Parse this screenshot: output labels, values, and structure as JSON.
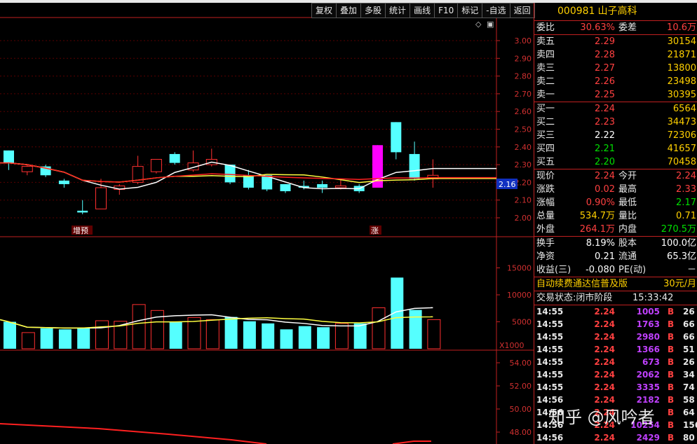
{
  "toolbar": [
    "复权",
    "叠加",
    "多股",
    "统计",
    "画线",
    "F10",
    "标记",
    "-自选",
    "返回"
  ],
  "stock": {
    "code": "000981",
    "name": "山子高科"
  },
  "ratio": {
    "label1": "委比",
    "value1": "30.63%",
    "label2": "委差",
    "value2": "10.6万"
  },
  "asks": [
    {
      "label": "卖五",
      "price": "2.29",
      "vol": "30154"
    },
    {
      "label": "卖四",
      "price": "2.28",
      "vol": "21871"
    },
    {
      "label": "卖三",
      "price": "2.27",
      "vol": "13800"
    },
    {
      "label": "卖二",
      "price": "2.26",
      "vol": "23498"
    },
    {
      "label": "卖一",
      "price": "2.25",
      "vol": "30395"
    }
  ],
  "bids": [
    {
      "label": "买一",
      "price": "2.24",
      "vol": "6564",
      "pc": "red"
    },
    {
      "label": "买二",
      "price": "2.23",
      "vol": "34473",
      "pc": "red"
    },
    {
      "label": "买三",
      "price": "2.22",
      "vol": "72306",
      "pc": "white"
    },
    {
      "label": "买四",
      "price": "2.21",
      "vol": "41657",
      "pc": "green"
    },
    {
      "label": "买五",
      "price": "2.20",
      "vol": "70458",
      "pc": "green"
    }
  ],
  "quote": [
    {
      "l1": "现价",
      "v1": "2.24",
      "v1c": "red",
      "l2": "今开",
      "v2": "2.24",
      "v2c": "red"
    },
    {
      "l1": "涨跌",
      "v1": "0.02",
      "v1c": "red",
      "l2": "最高",
      "v2": "2.33",
      "v2c": "red"
    },
    {
      "l1": "涨幅",
      "v1": "0.90%",
      "v1c": "red",
      "l2": "最低",
      "v2": "2.17",
      "v2c": "green"
    },
    {
      "l1": "总量",
      "v1": "534.7万",
      "v1c": "yellow",
      "l2": "量比",
      "v2": "0.71",
      "v2c": "yellow"
    },
    {
      "l1": "外盘",
      "v1": "264.1万",
      "v1c": "red",
      "l2": "内盘",
      "v2": "270.5万",
      "v2c": "green"
    }
  ],
  "fundamentals": [
    {
      "l1": "换手",
      "v1": "8.19%",
      "l2": "股本",
      "v2": "100.0亿"
    },
    {
      "l1": "净资",
      "v1": "0.21",
      "l2": "流通",
      "v2": "65.3亿"
    },
    {
      "l1": "收益(三)",
      "v1": "-0.080",
      "l2": "PE(动)",
      "v2": "－"
    }
  ],
  "promo": {
    "text": "自动续费通达信普及版",
    "price": "30元/月"
  },
  "status": {
    "text": "交易状态:闭市阶段",
    "time": "15:33:42"
  },
  "ticks": [
    {
      "time": "14:55",
      "price": "2.24",
      "vol": "1005",
      "bs": "B",
      "n": "26"
    },
    {
      "time": "14:55",
      "price": "2.24",
      "vol": "1763",
      "bs": "B",
      "n": "66"
    },
    {
      "time": "14:55",
      "price": "2.24",
      "vol": "2980",
      "bs": "B",
      "n": "66"
    },
    {
      "time": "14:55",
      "price": "2.24",
      "vol": "1366",
      "bs": "B",
      "n": "51"
    },
    {
      "time": "14:55",
      "price": "2.24",
      "vol": "673",
      "bs": "B",
      "n": "26"
    },
    {
      "time": "14:55",
      "price": "2.24",
      "vol": "2062",
      "bs": "B",
      "n": "34"
    },
    {
      "time": "14:55",
      "price": "2.24",
      "vol": "3335",
      "bs": "B",
      "n": "74"
    },
    {
      "time": "14:56",
      "price": "2.24",
      "vol": "2182",
      "bs": "B",
      "n": "58"
    },
    {
      "time": "14:56",
      "price": "2.24",
      "vol": "",
      "bs": "B",
      "n": "64"
    },
    {
      "time": "14:56",
      "price": "2.24",
      "vol": "10254",
      "bs": "B",
      "n": "156"
    },
    {
      "time": "14:56",
      "price": "2.24",
      "vol": "2429",
      "bs": "B",
      "n": "80"
    }
  ],
  "watermark": "知乎 @风吟者",
  "chart_data": {
    "type": "candlestick",
    "price_axis": [
      "3.00",
      "2.90",
      "2.80",
      "2.70",
      "2.60",
      "2.50",
      "2.40",
      "2.30",
      "2.20",
      "2.10",
      "2.00"
    ],
    "current_price_label": "2.16",
    "annotations": [
      "增预",
      "涨"
    ],
    "volume_axis": [
      "15000",
      "10000",
      "5000"
    ],
    "volume_unit": "X1000",
    "indicator_axis": [
      "54.00",
      "52.00",
      "50.00",
      "48.00"
    ],
    "candles": [
      {
        "o": 2.38,
        "c": 2.31,
        "h": 2.38,
        "l": 2.27
      },
      {
        "o": 2.26,
        "c": 2.29,
        "h": 2.3,
        "l": 2.24
      },
      {
        "o": 2.29,
        "c": 2.24,
        "h": 2.3,
        "l": 2.23
      },
      {
        "o": 2.21,
        "c": 2.19,
        "h": 2.22,
        "l": 2.17
      },
      {
        "o": 2.04,
        "c": 2.03,
        "h": 2.1,
        "l": 2.02
      },
      {
        "o": 2.05,
        "c": 2.17,
        "h": 2.22,
        "l": 2.05
      },
      {
        "o": 2.16,
        "c": 2.18,
        "h": 2.19,
        "l": 2.13
      },
      {
        "o": 2.2,
        "c": 2.29,
        "h": 2.35,
        "l": 2.19
      },
      {
        "o": 2.26,
        "c": 2.33,
        "h": 2.33,
        "l": 2.25
      },
      {
        "o": 2.36,
        "c": 2.31,
        "h": 2.37,
        "l": 2.3
      },
      {
        "o": 2.27,
        "c": 2.31,
        "h": 2.38,
        "l": 2.26
      },
      {
        "o": 2.3,
        "c": 2.33,
        "h": 2.39,
        "l": 2.29
      },
      {
        "o": 2.3,
        "c": 2.2,
        "h": 2.3,
        "l": 2.19
      },
      {
        "o": 2.24,
        "c": 2.17,
        "h": 2.27,
        "l": 2.16
      },
      {
        "o": 2.24,
        "c": 2.16,
        "h": 2.24,
        "l": 2.15
      },
      {
        "o": 2.19,
        "c": 2.15,
        "h": 2.19,
        "l": 2.14
      },
      {
        "o": 2.18,
        "c": 2.17,
        "h": 2.21,
        "l": 2.16
      },
      {
        "o": 2.19,
        "c": 2.17,
        "h": 2.21,
        "l": 2.14
      },
      {
        "o": 2.17,
        "c": 2.18,
        "h": 2.22,
        "l": 2.16
      },
      {
        "o": 2.18,
        "c": 2.15,
        "h": 2.19,
        "l": 2.14
      },
      {
        "o": 2.17,
        "c": 2.41,
        "h": 2.41,
        "l": 2.17
      },
      {
        "o": 2.54,
        "c": 2.37,
        "h": 2.54,
        "l": 2.33
      },
      {
        "o": 2.36,
        "c": 2.22,
        "h": 2.43,
        "l": 2.21
      },
      {
        "o": 2.22,
        "c": 2.24,
        "h": 2.33,
        "l": 2.17
      }
    ],
    "volumes": [
      5000,
      3000,
      3800,
      3600,
      3800,
      5200,
      5100,
      8200,
      7100,
      5000,
      5800,
      5400,
      5900,
      5100,
      4700,
      3600,
      4200,
      4000,
      4700,
      4700,
      7600,
      13200,
      7200,
      5400
    ]
  }
}
